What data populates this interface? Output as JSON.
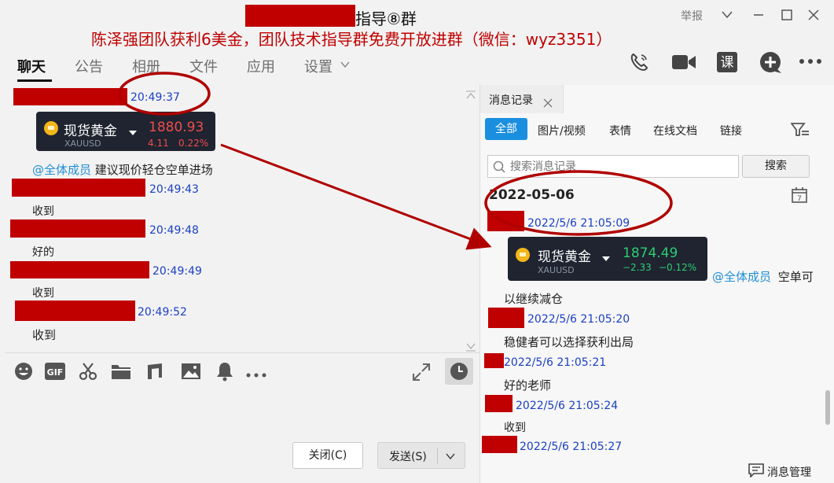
{
  "window": {
    "title": "指导⑧群",
    "report_label": "举报",
    "banner": "陈泽强团队获利6美金，团队技术指导群免费开放进群（微信：wyz3351）"
  },
  "tabs": [
    {
      "label": "聊天"
    },
    {
      "label": "公告"
    },
    {
      "label": "相册"
    },
    {
      "label": "文件"
    },
    {
      "label": "应用"
    },
    {
      "label": "设置"
    }
  ],
  "header_icons": [
    "phone-icon",
    "video-call-icon",
    "course-icon",
    "add-icon",
    "more-icon"
  ],
  "course_label": "课",
  "chat": {
    "messages": [
      {
        "time": "20:49:37"
      },
      {
        "card": {
          "name": "现货黄金",
          "symbol": "XAUUSD",
          "price": "1880.93",
          "change": "4.11",
          "pct": "0.22%"
        }
      },
      {
        "mention": "@全体成员",
        "text": "建议现价轻仓空单进场"
      },
      {
        "time": "20:49:43",
        "text": "收到"
      },
      {
        "time": "20:49:48",
        "text": "好的"
      },
      {
        "time": "20:49:49",
        "text": "收到"
      },
      {
        "time": "20:49:52",
        "text": "收到"
      }
    ]
  },
  "toolbar_icons": [
    "emoji-icon",
    "gif-icon",
    "scissors-icon",
    "folder-icon",
    "music-icon",
    "image-icon",
    "bell-icon",
    "more-dots-icon"
  ],
  "buttons": {
    "close": "关闭(C)",
    "send": "发送(S)"
  },
  "history": {
    "tab_label": "消息记录",
    "filters": [
      "全部",
      "图片/视频",
      "表情",
      "在线文档",
      "链接"
    ],
    "search_placeholder": "搜索消息记录",
    "search_button": "搜索",
    "date": "2022-05-06",
    "entries": [
      {
        "time": "2022/5/6 21:05:09"
      },
      {
        "card": {
          "name": "现货黄金",
          "symbol": "XAUUSD",
          "price": "1874.49",
          "change": "−2.33",
          "pct": "−0.12%"
        }
      },
      {
        "mention": "@全体成员",
        "text": "空单可",
        "text2": "以继续减仓"
      },
      {
        "time": "2022/5/6 21:05:20",
        "text": "稳健者可以选择获利出局"
      },
      {
        "time": "2022/5/6 21:05:21",
        "text": "好的老师"
      },
      {
        "time": "2022/5/6 21:05:24",
        "text": "收到"
      },
      {
        "time": "2022/5/6 21:05:27"
      }
    ],
    "manage_label": "消息管理"
  },
  "colors": {
    "redact": "#c00000",
    "accent": "#1f8ed6",
    "time": "#1a3fc4",
    "up": "#ef4b4b",
    "down": "#2ecc71",
    "annotation": "#c00000"
  }
}
